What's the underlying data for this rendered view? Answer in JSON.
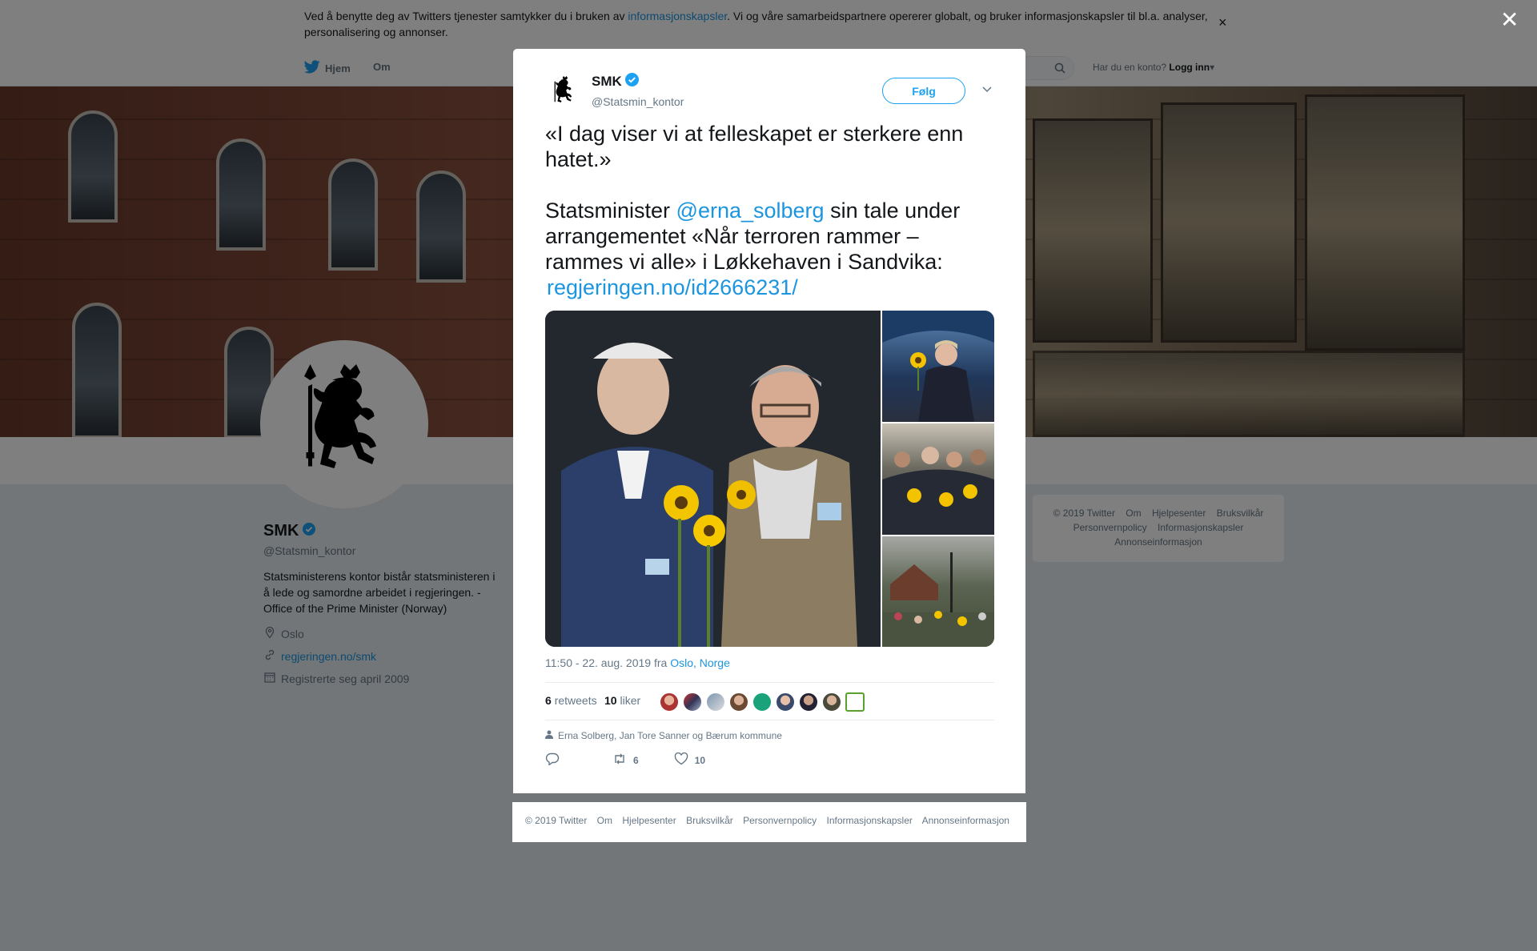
{
  "cookie_bar": {
    "text_before": "Ved å benytte deg av Twitters tjenester samtykker du i bruken av ",
    "link": "informasjonskapsler",
    "text_after": ". Vi og våre samarbeidspartnere opererer globalt, og bruker informasjonskapsler til bl.a. analyser, personalisering og annonser.",
    "close": "×"
  },
  "nav": {
    "home": "Hjem",
    "about": "Om",
    "account_prompt": "Har du en konto?",
    "login": "Logg inn"
  },
  "profile": {
    "name": "SMK",
    "handle": "@Statsmin_kontor",
    "bio": "Statsministerens kontor bistår statsministeren i å lede og samordne arbeidet i regjeringen. - Office of the Prime Minister (Norway)",
    "location": "Oslo",
    "website": "regjeringen.no/smk",
    "joined": "Registrerte seg april 2009"
  },
  "side_footer": {
    "items": [
      "© 2019 Twitter",
      "Om",
      "Hjelpesenter",
      "Bruksvilkår",
      "Personvernpolicy",
      "Informasjonskapsler",
      "Annonseinformasjon"
    ]
  },
  "overlay_close": "✕",
  "tweet": {
    "author_name": "SMK",
    "author_handle": "@Statsmin_kontor",
    "follow_label": "Følg",
    "text_line1": "«I dag viser vi at felleskapet er sterkere enn hatet.»",
    "text_pre_mention": "Statsminister ",
    "mention": "@erna_solberg",
    "text_post_mention": " sin tale under arrangementet «Når terroren rammer – rammes vi alle» i Løkkehaven i Sandvika:",
    "link": "regjeringen.no/id2666231/",
    "timestamp": "11:50 - 22. aug. 2019 fra ",
    "place": "Oslo, Norge",
    "retweets_count": "6",
    "retweets_label": "retweets",
    "likes_count": "10",
    "likes_label": "liker",
    "mentioned": "Erna Solberg, Jan Tore Sanner og Bærum kommune",
    "action_retweet_count": "6",
    "action_like_count": "10"
  },
  "modal_footer": {
    "items": [
      "© 2019 Twitter",
      "Om",
      "Hjelpesenter",
      "Bruksvilkår",
      "Personvernpolicy",
      "Informasjonskapsler",
      "Annonseinformasjon"
    ]
  },
  "colors": {
    "link": "#1b95e0",
    "verified": "#1da1f2",
    "muted": "#657786"
  }
}
